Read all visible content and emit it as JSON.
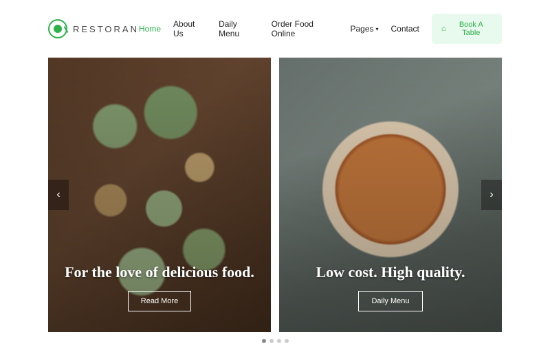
{
  "brand": {
    "name": "RESTORAN"
  },
  "nav": {
    "items": [
      {
        "label": "Home",
        "active": true
      },
      {
        "label": "About Us",
        "active": false
      },
      {
        "label": "Daily Menu",
        "active": false
      },
      {
        "label": "Order Food Online",
        "active": false
      },
      {
        "label": "Pages",
        "active": false,
        "dropdown": true
      },
      {
        "label": "Contact",
        "active": false
      }
    ],
    "cta": "Book A Table"
  },
  "slides": [
    {
      "title": "For the love of delicious food.",
      "button": "Read More"
    },
    {
      "title": "Low cost. High quality.",
      "button": "Daily Menu"
    }
  ],
  "carousel": {
    "total_dots": 4,
    "active_dot": 0
  }
}
